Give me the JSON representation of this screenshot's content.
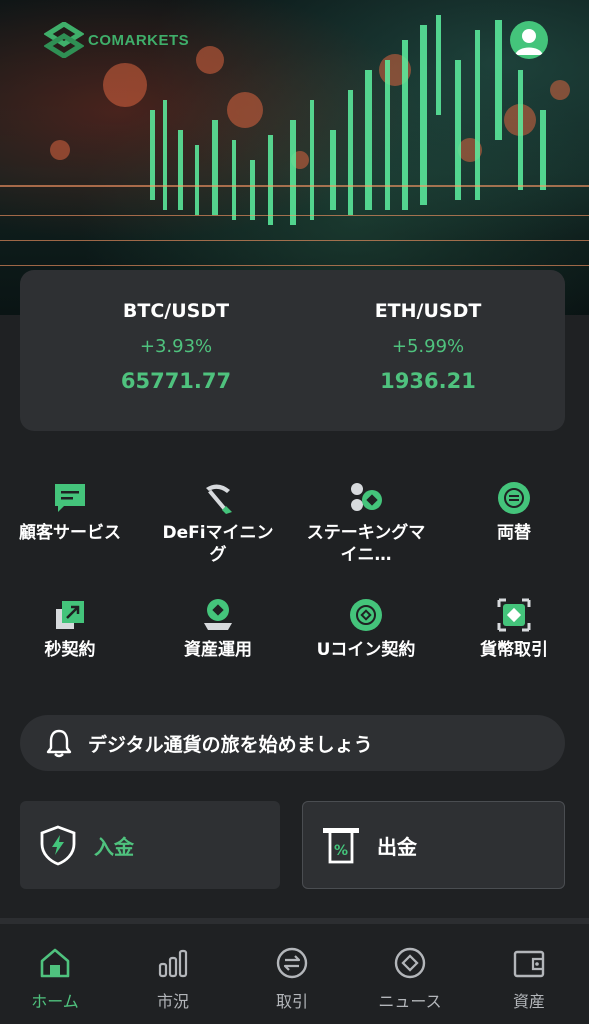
{
  "brand": {
    "logo_text": "COMARKETS"
  },
  "ticker": [
    {
      "pair": "BTC/USDT",
      "change": "+3.93%",
      "price": "65771.77"
    },
    {
      "pair": "ETH/USDT",
      "change": "+5.99%",
      "price": "1936.21"
    }
  ],
  "features": [
    {
      "label": "顧客サービス",
      "icon": "chat-icon"
    },
    {
      "label": "DeFiマイニング",
      "icon": "pickaxe-icon"
    },
    {
      "label": "ステーキングマイニ…",
      "icon": "coins-icon"
    },
    {
      "label": "両替",
      "icon": "exchange-icon"
    },
    {
      "label": "秒契約",
      "icon": "trend-arrow-icon"
    },
    {
      "label": "資産運用",
      "icon": "coin-hand-icon"
    },
    {
      "label": "Uコイン契約",
      "icon": "u-coin-icon"
    },
    {
      "label": "貨幣取引",
      "icon": "currency-trade-icon"
    }
  ],
  "notice": {
    "text": "デジタル通貨の旅を始めましょう"
  },
  "actions": {
    "deposit": "入金",
    "withdraw": "出金"
  },
  "nav": [
    {
      "label": "ホーム",
      "active": true
    },
    {
      "label": "市況"
    },
    {
      "label": "取引"
    },
    {
      "label": "ニュース"
    },
    {
      "label": "資産"
    }
  ],
  "colors": {
    "accent": "#4fc27e",
    "card": "#2e3033",
    "background": "#1f2123"
  }
}
